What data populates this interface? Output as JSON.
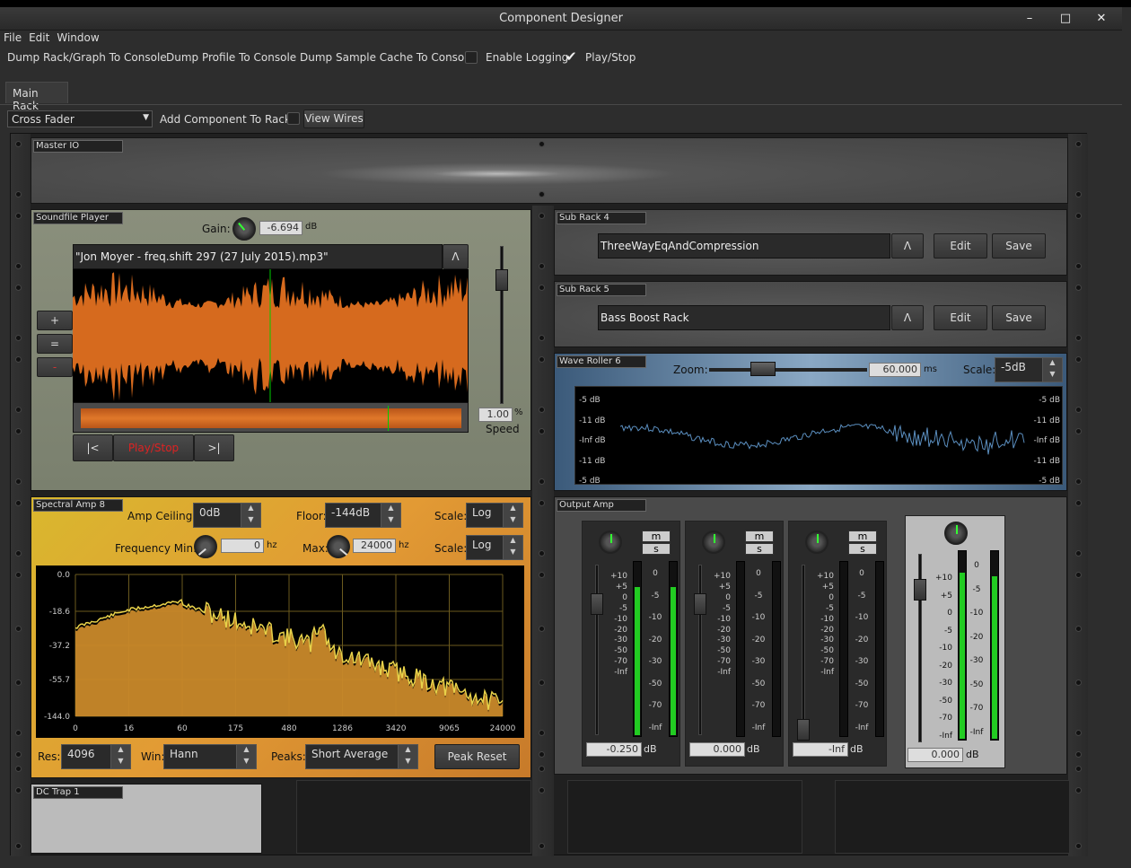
{
  "window": {
    "title": "Component Designer",
    "minimize": "–",
    "maximize": "□",
    "close": "✕"
  },
  "menu": [
    "File",
    "Edit",
    "Window"
  ],
  "toolbar": {
    "dump_rack": "Dump Rack/Graph To Console",
    "dump_profile": "Dump Profile To Console",
    "dump_sample": "Dump Sample Cache To Console",
    "enable_logging": "Enable Logging",
    "play_stop": "Play/Stop",
    "logging_checked": false,
    "playstop_checked": true
  },
  "tabs": [
    "Main Rack"
  ],
  "rackbar": {
    "component_select": "Cross Fader",
    "add_label": "Add Component To Rack",
    "view_wires": "View Wires"
  },
  "master_io": {
    "name": "Master IO"
  },
  "soundfile": {
    "name": "Soundfile Player",
    "gain_label": "Gain:",
    "gain": "-6.694",
    "gain_unit": "dB",
    "filename": "\"Jon Moyer - freq.shift 297 (27 July 2015).mp3\"",
    "up": "Λ",
    "plus": "+",
    "eq": "=",
    "minus": "-",
    "speed": "1.00",
    "speed_unit": "%",
    "speed_label": "Speed",
    "prev": "|<",
    "play": "Play/Stop",
    "next": ">|"
  },
  "subrack4": {
    "name": "Sub Rack 4",
    "value": "ThreeWayEqAndCompression",
    "up": "Λ",
    "edit": "Edit",
    "save": "Save"
  },
  "subrack5": {
    "name": "Sub Rack 5",
    "value": "Bass Boost Rack",
    "up": "Λ",
    "edit": "Edit",
    "save": "Save"
  },
  "waveroller": {
    "name": "Wave Roller 6",
    "zoom_label": "Zoom:",
    "zoom": "60.000",
    "zoom_unit": "ms",
    "scale_label": "Scale:",
    "scale": "-5dB",
    "db_labels": [
      "-5 dB",
      "-11 dB",
      "-Inf dB",
      "-11 dB",
      "-5 dB"
    ]
  },
  "spectral": {
    "name": "Spectral Amp 8",
    "ceiling_label": "Amp Ceiling:",
    "ceiling": "0dB",
    "floor_label": "Floor:",
    "floor": "-144dB",
    "scale_label": "Scale:",
    "scale1": "Log",
    "fmin_label": "Frequency Min:",
    "fmin": "0",
    "fmin_unit": "hz",
    "max_label": "Max:",
    "fmax": "24000",
    "fmax_unit": "hz",
    "scale2": "Log",
    "res_label": "Res:",
    "res": "4096",
    "win_label": "Win:",
    "win": "Hann",
    "peaks_label": "Peaks:",
    "peaks": "Short Average",
    "peak_reset": "Peak Reset",
    "y_ticks": [
      "0.0",
      "-18.6",
      "-37.2",
      "-55.7",
      "-144.0"
    ],
    "x_ticks": [
      "0",
      "16",
      "60",
      "175",
      "480",
      "1286",
      "3420",
      "9065",
      "24000"
    ]
  },
  "output": {
    "name": "Output Amp",
    "m": "m",
    "s": "s",
    "channels": [
      {
        "value": "-0.250",
        "unit": "dB",
        "level": 0.85
      },
      {
        "value": "0.000",
        "unit": "dB",
        "level": 0.0
      },
      {
        "value": "-Inf",
        "unit": "dB",
        "level": 0.0
      }
    ],
    "master": {
      "value": "0.000",
      "unit": "dB",
      "level": 0.9
    },
    "scale": [
      "+10",
      "+5",
      "0",
      "-5",
      "-10",
      "-20",
      "-30",
      "-50",
      "-70",
      "-Inf"
    ],
    "meter_scale": [
      "0",
      "-5",
      "-10",
      "-20",
      "-30",
      "-50",
      "-70",
      "-Inf"
    ]
  },
  "dctrap": {
    "name": "DC Trap 1"
  }
}
